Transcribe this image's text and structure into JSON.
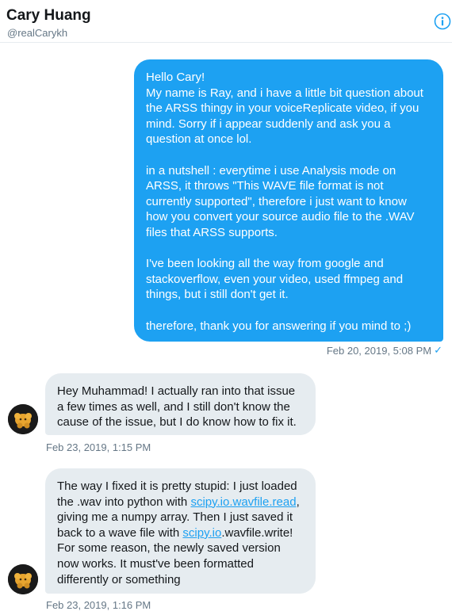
{
  "header": {
    "name": "Cary Huang",
    "handle": "@realCarykh",
    "info_icon": "info-icon"
  },
  "messages": [
    {
      "direction": "outgoing",
      "paragraphs": [
        "Hello Cary!\nMy name is Ray, and i have a little bit question about the ARSS thingy in your voiceReplicate video, if you mind. Sorry if i appear suddenly and ask you a question at once lol.",
        "in a nutshell : everytime i use Analysis mode on ARSS, it throws \"This WAVE file format is not currently supported\", therefore i just want to know how you convert your source audio file to the .WAV files that ARSS supports.",
        "I've been looking all the way from google and stackoverflow, even your video, used ffmpeg and things, but i still don't get it.",
        "therefore, thank you for answering if you mind to ;)"
      ],
      "timestamp": "Feb 20, 2019, 5:08 PM",
      "status_icon": "check-icon"
    },
    {
      "direction": "incoming",
      "text": "Hey Muhammad! I actually ran into that issue a few times as well, and I still don't know the cause of the issue, but I do know how to fix it.",
      "timestamp": "Feb 23, 2019, 1:15 PM"
    },
    {
      "direction": "incoming",
      "segments": [
        "The way I fixed it is pretty stupid: I just loaded the .wav into python with ",
        "scipy.io.wavfile.read",
        ", giving me a numpy array. Then I just saved it back to a wave file with ",
        "scipy.io",
        ".wavfile.write! For some reason, the newly saved version now works. It must've been formatted differently or something"
      ],
      "timestamp": "Feb 23, 2019, 1:16 PM"
    }
  ],
  "colors": {
    "accent": "#1da1f2",
    "incoming_bubble": "#e6ecf0",
    "muted_text": "#657786"
  }
}
